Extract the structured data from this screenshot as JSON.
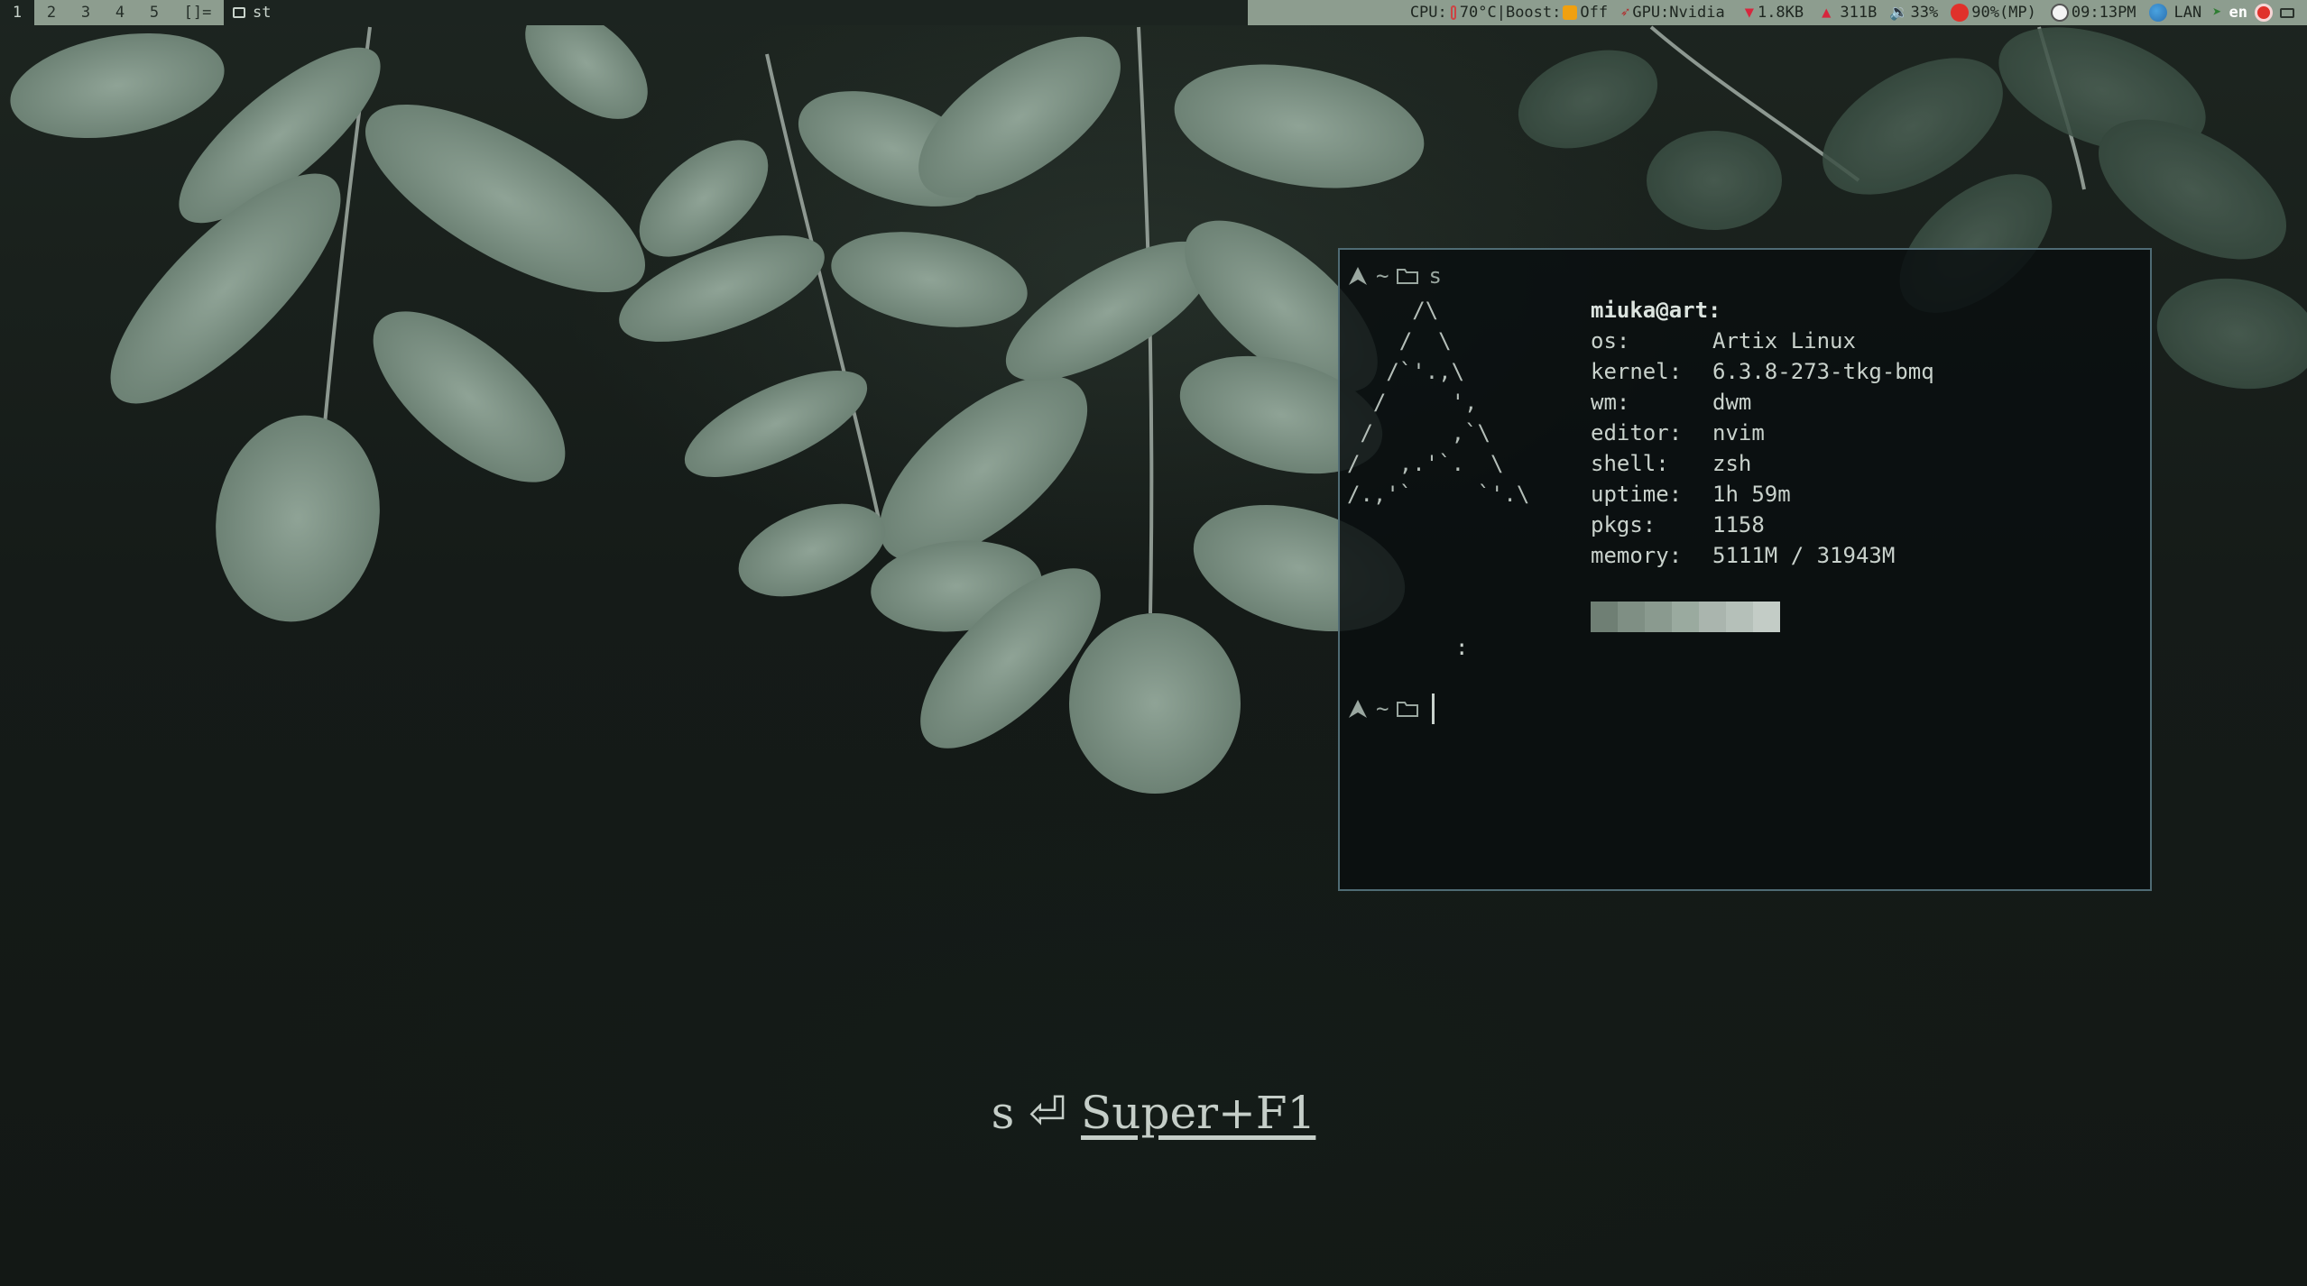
{
  "topbar": {
    "tags": [
      "1",
      "2",
      "3",
      "4",
      "5"
    ],
    "active_tag": "1",
    "layout": "[]=",
    "window_title": "st",
    "window_icon": "terminal-icon",
    "status": {
      "cpu_label": "CPU:",
      "cpu_temp": "70°C",
      "boost_label": "|Boost:",
      "boost_value": "Off",
      "gpu": "GPU:Nvidia",
      "net_down": "1.8KB",
      "net_up": "311B",
      "volume": "33%",
      "battery": "90%(MP)",
      "clock": "09:13PM",
      "network": "LAN",
      "keyboard_layout": "en"
    },
    "colors": {
      "bar_bg": "#8d9d8f",
      "bar_active": "#1c2420",
      "down_arrow": "#d7263d",
      "up_arrow": "#d7263d",
      "battery_red": "#e0312b",
      "boost_orange": "#f0a010"
    }
  },
  "terminal": {
    "prompt_tilde": "~",
    "command": "s",
    "ascii_art": "     /\\\n    /  \\\n   /`'.,\\\n  /     ',\n /      ,`\\\n/   ,.'`.  \\\n/.,'`     `'.\\",
    "userhost": "miuka@art:",
    "info": [
      {
        "key": "os:",
        "value": "Artix Linux"
      },
      {
        "key": "kernel:",
        "value": "6.3.8-273-tkg-bmq"
      },
      {
        "key": "wm:",
        "value": "dwm"
      },
      {
        "key": "editor:",
        "value": "nvim"
      },
      {
        "key": "shell:",
        "value": "zsh"
      },
      {
        "key": "uptime:",
        "value": "1h 59m"
      },
      {
        "key": "pkgs:",
        "value": "1158"
      },
      {
        "key": "memory:",
        "value": "5111M / 31943M"
      }
    ],
    "palette": [
      "#6f7f74",
      "#7f8f84",
      "#8a9a8f",
      "#9aaa9f",
      "#aab5ae",
      "#b5c0b9",
      "#c3ccc6"
    ],
    "colon": ":",
    "border_color": "#4f6b74"
  },
  "hint": {
    "command": "s",
    "enter_glyph": "⏎",
    "shortcut": "Super+F1"
  }
}
